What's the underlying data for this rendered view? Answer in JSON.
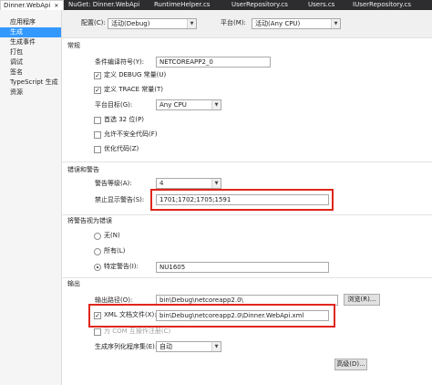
{
  "tabs": [
    {
      "label": "Dinner.WebApi",
      "active": true
    },
    {
      "label": "NuGet: Dinner.WebApi",
      "active": false
    },
    {
      "label": "RuntimeHelper.cs",
      "active": false
    },
    {
      "label": "UserRepository.cs",
      "active": false
    },
    {
      "label": "Users.cs",
      "active": false
    },
    {
      "label": "IUserRepository.cs",
      "active": false
    }
  ],
  "nav": {
    "items": [
      "应用程序",
      "生成",
      "生成事件",
      "打包",
      "调试",
      "签名",
      "TypeScript 生成",
      "资源"
    ],
    "active_index": 1
  },
  "config_bar": {
    "config_label": "配置(C):",
    "config_value": "活动(Debug)",
    "platform_label": "平台(M):",
    "platform_value": "活动(Any CPU)"
  },
  "general": {
    "header": "常规",
    "symbols_label": "条件编译符号(Y):",
    "symbols_value": "NETCOREAPP2_0",
    "define_debug_label": "定义 DEBUG 常量(U)",
    "define_debug_checked": true,
    "define_trace_label": "定义 TRACE 常量(T)",
    "define_trace_checked": true,
    "platform_target_label": "平台目标(G):",
    "platform_target_value": "Any CPU",
    "prefer32_label": "首选 32 位(P)",
    "prefer32_checked": false,
    "unsafe_label": "允许不安全代码(F)",
    "unsafe_checked": false,
    "optimize_label": "优化代码(Z)",
    "optimize_checked": false
  },
  "errors": {
    "header": "错误和警告",
    "warning_level_label": "警告等级(A):",
    "warning_level_value": "4",
    "suppress_label": "禁止显示警告(S):",
    "suppress_value": "1701;1702;1705;1591"
  },
  "treat_warnings": {
    "header": "将警告视为错误",
    "none_label": "无(N)",
    "all_label": "所有(L)",
    "specific_label": "特定警告(I):",
    "selected": "specific",
    "specific_value": "NU1605"
  },
  "output": {
    "header": "输出",
    "path_label": "输出路径(O):",
    "path_value": "bin\\Debug\\netcoreapp2.0\\",
    "browse_label": "浏览(R)...",
    "xml_label": "XML 文档文件(X):",
    "xml_checked": true,
    "xml_value": "bin\\Debug\\netcoreapp2.0\\Dinner.WebApi.xml",
    "com_label": "为 COM 互操作注册(C)",
    "com_checked": false,
    "serialization_label": "生成序列化程序集(E):",
    "serialization_value": "自动",
    "advanced_label": "高级(D)..."
  },
  "colors": {
    "accent": "#3399ff",
    "highlight_box": "#e0261b",
    "tab_bar": "#2d2d30"
  }
}
